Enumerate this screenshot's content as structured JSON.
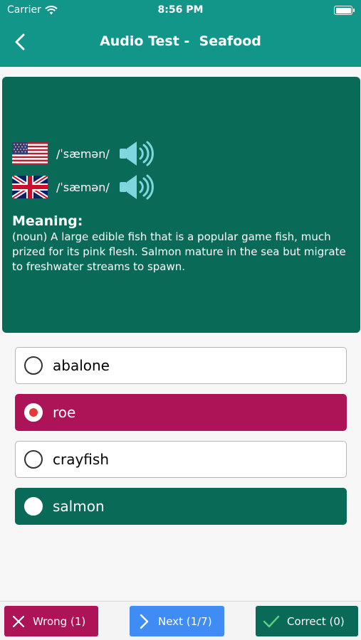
{
  "status_bar": {
    "carrier": "Carrier",
    "time": "8:56 PM"
  },
  "header": {
    "title": "Audio Test -  Seafood",
    "back_icon": "chevron-left-icon"
  },
  "card": {
    "pronunciations": [
      {
        "flag": "us-flag-icon",
        "ipa": "/ˈsæmən/",
        "icon": "speaker-icon"
      },
      {
        "flag": "uk-flag-icon",
        "ipa": "/ˈsæmən/",
        "icon": "speaker-icon"
      }
    ],
    "meaning_title": "Meaning:",
    "meaning_text": "(noun) A large edible fish that is a popular game fish, much prized for its pink flesh. Salmon mature in the sea but migrate to freshwater streams to spawn."
  },
  "options": [
    {
      "label": "abalone",
      "state": "default"
    },
    {
      "label": "roe",
      "state": "wrong-selected"
    },
    {
      "label": "crayfish",
      "state": "default"
    },
    {
      "label": "salmon",
      "state": "correct"
    }
  ],
  "bottom_bar": {
    "wrong_label": "Wrong (1)",
    "next_label": "Next (1/7)",
    "correct_label": "Correct (0)"
  },
  "colors": {
    "header": "#13968a",
    "card": "#0a6a58",
    "wrong": "#ad1457",
    "next": "#3f8cf5",
    "correct": "#0a6a58"
  }
}
